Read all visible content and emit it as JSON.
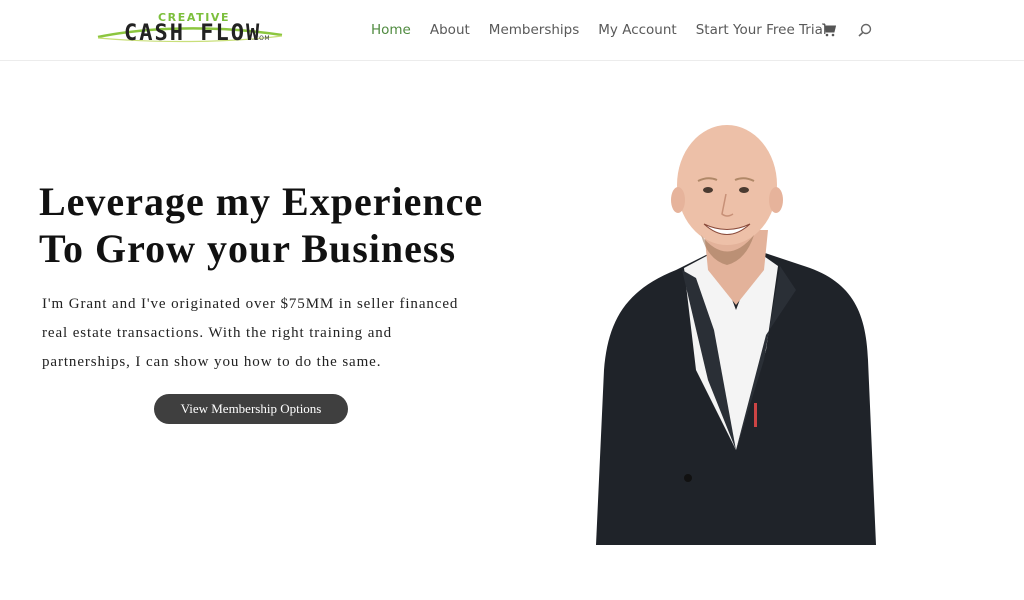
{
  "logo": {
    "top": "CREATIVE",
    "main": "CASH FLOW",
    "suffix": ".COM"
  },
  "nav": {
    "items": [
      {
        "label": "Home",
        "active": true
      },
      {
        "label": "About",
        "active": false
      },
      {
        "label": "Memberships",
        "active": false
      },
      {
        "label": "My Account",
        "active": false
      },
      {
        "label": "Start Your Free Trial",
        "active": false
      }
    ],
    "cart_icon": "shopping-cart-icon",
    "search_icon": "search-icon"
  },
  "hero": {
    "title_line1": "Leverage my Experience",
    "title_line2": "To Grow your Business",
    "text_line1": "I'm Grant and I've originated over $75MM in seller financed",
    "text_line2": "real estate transactions. With the right training and",
    "text_line3": "partnerships, I can show you how to do the same.",
    "button_label": "View Membership Options"
  },
  "colors": {
    "nav_active": "#4f8a3f",
    "logo_green": "#7cbf3c",
    "button_bg": "#3f3f3f"
  }
}
